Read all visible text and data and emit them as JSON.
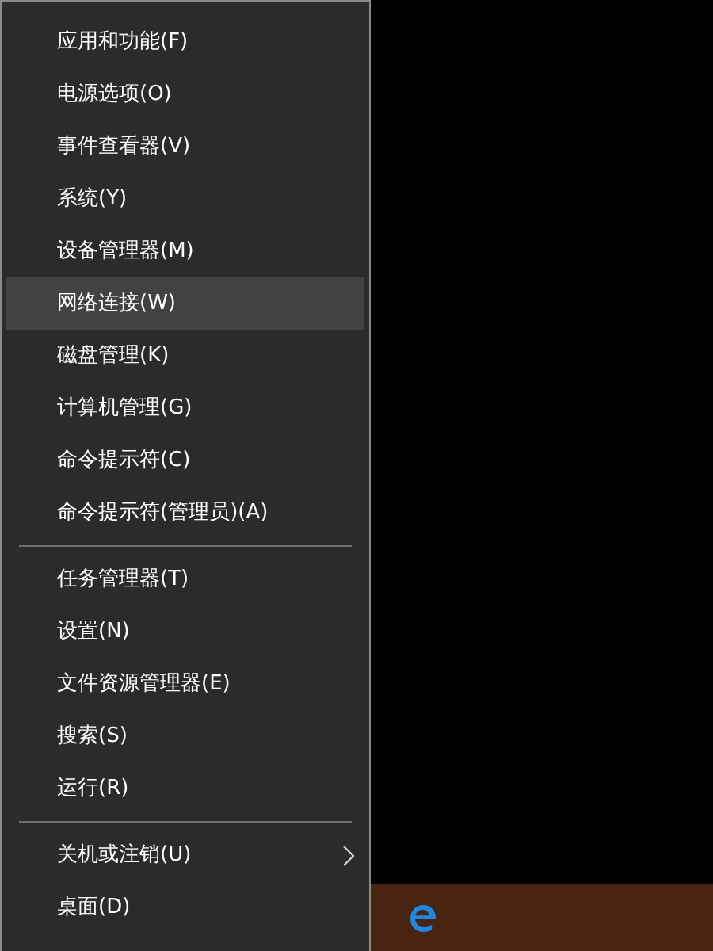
{
  "menu": {
    "sections": [
      {
        "items": [
          {
            "label": "应用和功能(F)",
            "selected": false,
            "submenu": false
          },
          {
            "label": "电源选项(O)",
            "selected": false,
            "submenu": false
          },
          {
            "label": "事件查看器(V)",
            "selected": false,
            "submenu": false
          },
          {
            "label": "系统(Y)",
            "selected": false,
            "submenu": false
          },
          {
            "label": "设备管理器(M)",
            "selected": false,
            "submenu": false
          },
          {
            "label": "网络连接(W)",
            "selected": true,
            "submenu": false
          },
          {
            "label": "磁盘管理(K)",
            "selected": false,
            "submenu": false
          },
          {
            "label": "计算机管理(G)",
            "selected": false,
            "submenu": false
          },
          {
            "label": "命令提示符(C)",
            "selected": false,
            "submenu": false
          },
          {
            "label": "命令提示符(管理员)(A)",
            "selected": false,
            "submenu": false
          }
        ]
      },
      {
        "items": [
          {
            "label": "任务管理器(T)",
            "selected": false,
            "submenu": false
          },
          {
            "label": "设置(N)",
            "selected": false,
            "submenu": false
          },
          {
            "label": "文件资源管理器(E)",
            "selected": false,
            "submenu": false
          },
          {
            "label": "搜索(S)",
            "selected": false,
            "submenu": false
          },
          {
            "label": "运行(R)",
            "selected": false,
            "submenu": false
          }
        ]
      },
      {
        "items": [
          {
            "label": "关机或注销(U)",
            "selected": false,
            "submenu": true
          },
          {
            "label": "桌面(D)",
            "selected": false,
            "submenu": false
          }
        ]
      }
    ]
  }
}
